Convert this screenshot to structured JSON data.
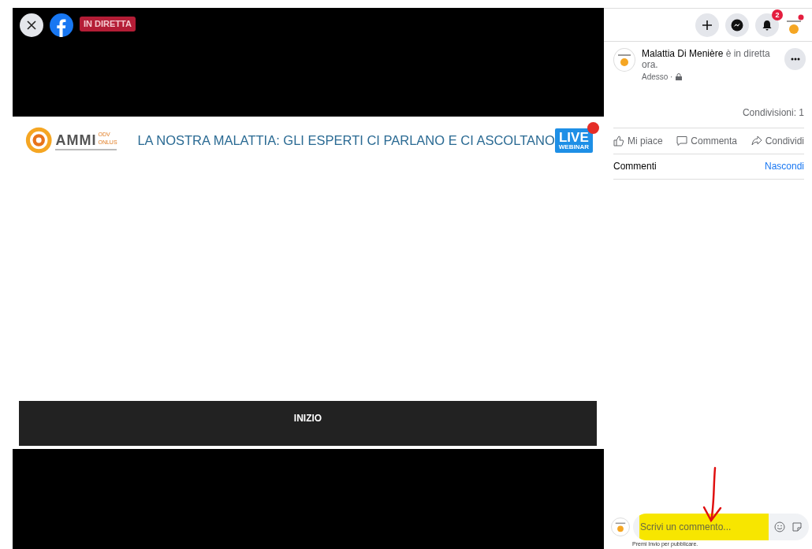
{
  "video": {
    "badge": "IN DIRETTA",
    "slide": {
      "logo_name": "AMMI",
      "logo_suffix": "ODV ONLUS",
      "title": "LA NOSTRA MALATTIA: GLI ESPERTI CI PARLANO E CI ASCOLTANO",
      "live_badge": [
        "LIVE",
        "WEBINAR"
      ],
      "bar_label": "INIZIO"
    }
  },
  "topbar": {
    "notification_count": "2"
  },
  "post": {
    "author": "Malattia Di Menière",
    "status": "è in diretta ora.",
    "time": "Adesso ·",
    "shares": "Condivisioni: 1",
    "actions": [
      {
        "kind": "like",
        "label": "Mi piace"
      },
      {
        "kind": "comment",
        "label": "Commenta"
      },
      {
        "kind": "share",
        "label": "Condividi"
      }
    ]
  },
  "comments": {
    "title": "Commenti",
    "toggle": "Nascondi",
    "placeholder": "Scrivi un commento...",
    "hint": "Premi Invio per pubblicare."
  }
}
